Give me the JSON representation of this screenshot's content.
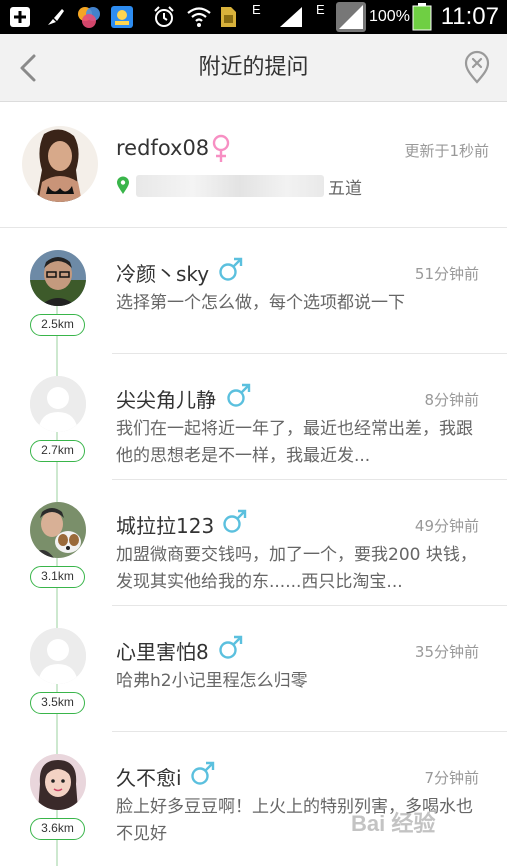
{
  "status_bar": {
    "battery_percent": "100%",
    "time": "11:07",
    "signal_labels": [
      "E",
      "E"
    ],
    "icons": [
      "add-box-icon",
      "brush-icon",
      "color-circles-icon",
      "photo-app-icon",
      "alarm-icon",
      "wifi-icon",
      "sim-icon",
      "signal-icon",
      "battery-icon"
    ]
  },
  "header": {
    "title": "附近的提问",
    "back_icon": "chevron-left-icon",
    "right_icon": "location-pin-icon"
  },
  "me": {
    "username": "redfox08",
    "gender": "female",
    "updated": "更新于1秒前",
    "address_suffix": "五道"
  },
  "colors": {
    "accent_green": "#39b54a",
    "female_pink": "#f78fc3",
    "male_blue": "#5bc0de"
  },
  "questions": [
    {
      "username": "冷颜丶sky",
      "gender": "male",
      "time": "51分钟前",
      "content": "选择第一个怎么做，每个选项都说一下",
      "distance": "2.5km",
      "avatar": "photo-man"
    },
    {
      "username": "尖尖角儿静",
      "gender": "male",
      "time": "8分钟前",
      "content": "我们在一起将近一年了，最近也经常出差，我跟他的思想老是不一样，我最近发...",
      "distance": "2.7km",
      "avatar": "default"
    },
    {
      "username": "城拉拉123",
      "gender": "male",
      "time": "49分钟前",
      "content": "加盟微商要交钱吗，加了一个，要我200 块钱，发现其实他给我的东......西只比淘宝...",
      "distance": "3.1km",
      "avatar": "photo-dog"
    },
    {
      "username": "心里害怕8",
      "gender": "male",
      "time": "35分钟前",
      "content": "哈弗h2小记里程怎么归零",
      "distance": "3.5km",
      "avatar": "default"
    },
    {
      "username": "久不愈i",
      "gender": "male",
      "time": "7分钟前",
      "content": "脸上好多豆豆啊！上火上的特别列害，多喝水也不见好",
      "distance": "3.6km",
      "avatar": "photo-girl"
    }
  ],
  "watermark": "Bai 经验"
}
